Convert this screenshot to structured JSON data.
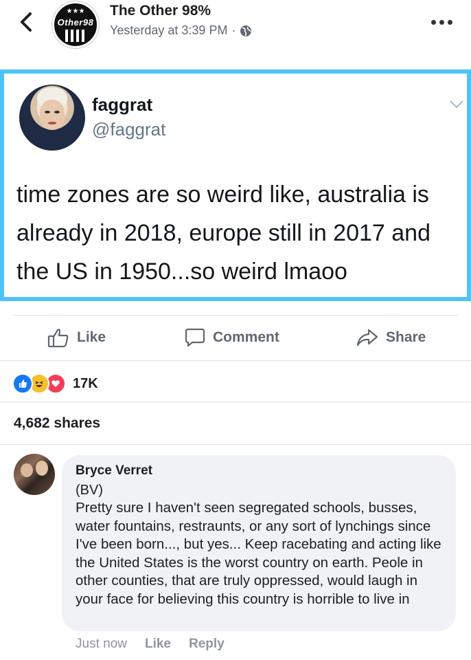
{
  "header": {
    "page_name": "The Other 98%",
    "timestamp": "Yesterday at 3:39 PM",
    "separator": "·",
    "privacy_icon": "globe-icon",
    "logo_text": "Other98",
    "logo_stars": "★★★"
  },
  "tweet": {
    "display_name": "faggrat",
    "handle": "@faggrat",
    "text": "time zones are so weird like, australia is already in 2018, europe still in 2017 and the US in 1950...so weird lmaoo",
    "border_color": "#4fc3f7"
  },
  "actions": {
    "like_label": "Like",
    "comment_label": "Comment",
    "share_label": "Share"
  },
  "reactions": {
    "icons": [
      "like-reaction",
      "haha-reaction",
      "love-reaction"
    ],
    "count": "17K"
  },
  "shares": {
    "text": "4,682 shares"
  },
  "comment": {
    "author": "Bryce Verret",
    "tag": "(BV)",
    "text": "Pretty sure I haven't seen segregated schools, busses, water fountains, restraunts, or any sort of lynchings since I've been born..., but yes... Keep racebating and acting like the United States is the worst country on earth. Peole in other counties, that are truly oppressed, would laugh in your face for believing this country is horrible to live in",
    "time": "Just now",
    "like_label": "Like",
    "reply_label": "Reply"
  },
  "colors": {
    "accent_blue": "#1877f2",
    "secondary_text": "#606770",
    "bubble_bg": "#f0f2f5"
  }
}
